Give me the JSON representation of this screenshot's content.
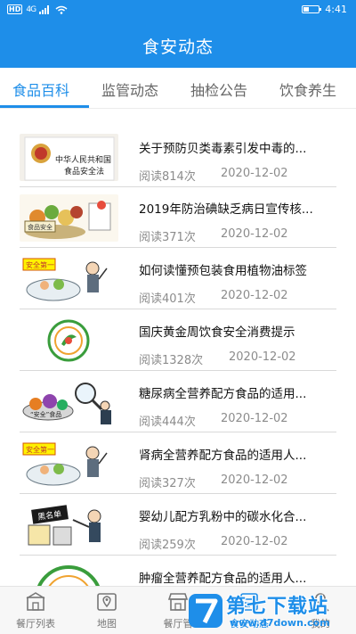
{
  "status_bar": {
    "hd": "HD",
    "network": "4G",
    "time": "4:41"
  },
  "header": {
    "title": "食安动态"
  },
  "tabs": [
    {
      "label": "食品百科",
      "active": true
    },
    {
      "label": "监管动态",
      "active": false
    },
    {
      "label": "抽检公告",
      "active": false
    },
    {
      "label": "饮食养生",
      "active": false
    }
  ],
  "news": [
    {
      "title": "关于预防贝类毒素引发中毒的...",
      "views": "阅读814次",
      "date": "2020-12-02",
      "thumb": "food-safety-law-book"
    },
    {
      "title": "2019年防治碘缺乏病日宣传核...",
      "views": "阅读371次",
      "date": "2020-12-02",
      "thumb": "food-safety-cartoon"
    },
    {
      "title": "如何读懂预包装食用植物油标签",
      "views": "阅读401次",
      "date": "2020-12-02",
      "thumb": "safety-first-cartoon"
    },
    {
      "title": "国庆黄金周饮食安全消费提示",
      "views": "阅读1328次",
      "date": "2020-12-02",
      "thumb": "green-food-logo"
    },
    {
      "title": "糖尿病全营养配方食品的适用...",
      "views": "阅读444次",
      "date": "2020-12-02",
      "thumb": "magnifier-cartoon"
    },
    {
      "title": "肾病全营养配方食品的适用人...",
      "views": "阅读327次",
      "date": "2020-12-02",
      "thumb": "safety-first-cartoon"
    },
    {
      "title": "婴幼儿配方乳粉中的碳水化合...",
      "views": "阅读259次",
      "date": "2020-12-02",
      "thumb": "blacklist-cartoon"
    },
    {
      "title": "肿瘤全营养配方食品的适用人...",
      "views": "",
      "date": "",
      "thumb": "green-food-logo"
    }
  ],
  "thumb_text": {
    "law_line1": "中华人民共和国",
    "law_line2": "食品安全法",
    "cartoon_sign": "食品安全",
    "safety_first": "安全第一",
    "safe_food": "“安全”食品",
    "blacklist": "黑名单"
  },
  "bottom_nav": [
    {
      "label": "餐厅列表",
      "icon": "building-icon"
    },
    {
      "label": "地图",
      "icon": "map-pin-icon"
    },
    {
      "label": "餐厅管",
      "icon": "store-icon"
    },
    {
      "label": "食安动态",
      "icon": "news-icon"
    },
    {
      "label": "我的",
      "icon": "person-icon"
    }
  ],
  "watermark": {
    "title": "第七下载站",
    "url": "www.d7down.com"
  },
  "colors": {
    "accent": "#1e8ee9",
    "tab_inactive": "#666666",
    "meta": "#8c8c8c"
  }
}
